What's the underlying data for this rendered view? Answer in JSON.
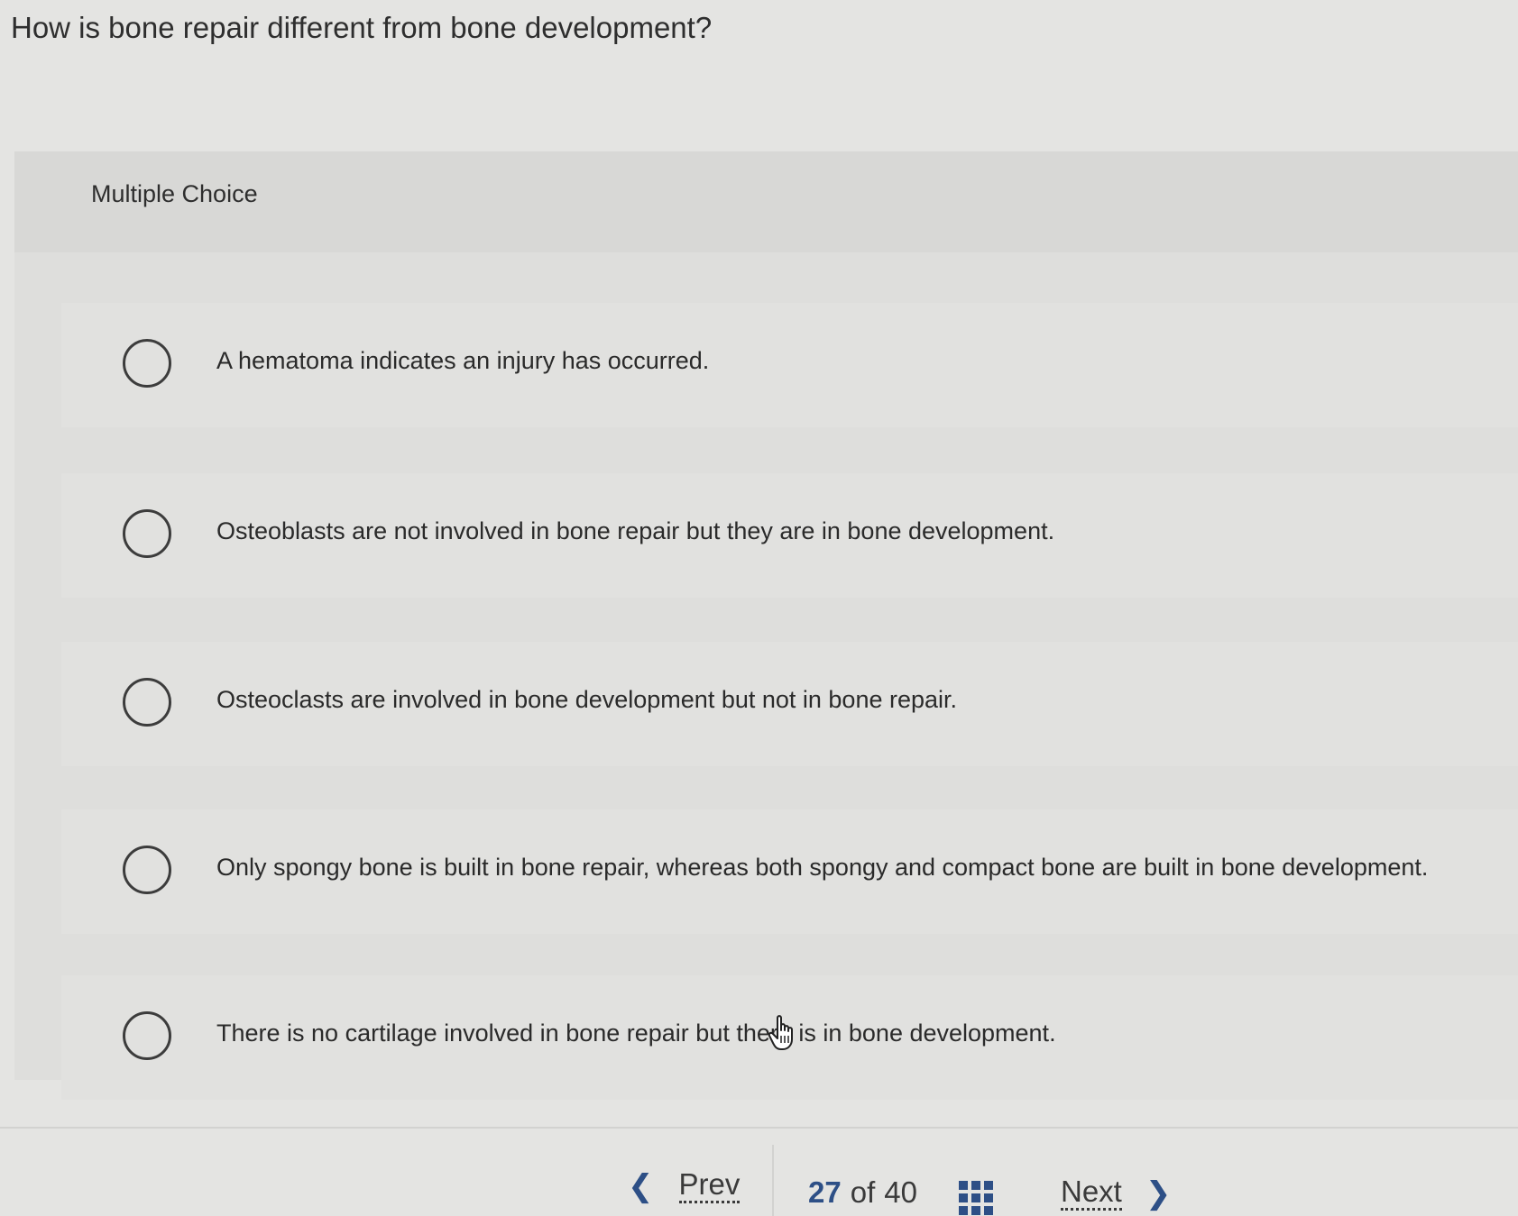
{
  "question": {
    "text": "How is bone repair different from bone development?"
  },
  "multiple_choice": {
    "label": "Multiple Choice",
    "options": [
      {
        "text": "A hematoma indicates an injury has occurred.",
        "selected": false
      },
      {
        "text": "Osteoblasts are not involved in bone repair but they are in bone development.",
        "selected": false
      },
      {
        "text": "Osteoclasts are involved in bone development but not in bone repair.",
        "selected": false
      },
      {
        "text": "Only spongy bone is built in bone repair, whereas both spongy and compact bone are built in bone development.",
        "selected": false
      },
      {
        "text": "There is no cartilage involved in bone repair but there is in bone development.",
        "selected": false
      }
    ]
  },
  "navigation": {
    "prev_label": "Prev",
    "next_label": "Next",
    "current_page": "27",
    "of_label": "of",
    "total_pages": "40",
    "prev_icon": "chevron-left-icon",
    "next_icon": "chevron-right-icon",
    "overview_icon": "grid-icon"
  },
  "colors": {
    "accent": "#2d4f86",
    "background": "#e4e4e2",
    "text": "#2b2b2b"
  }
}
